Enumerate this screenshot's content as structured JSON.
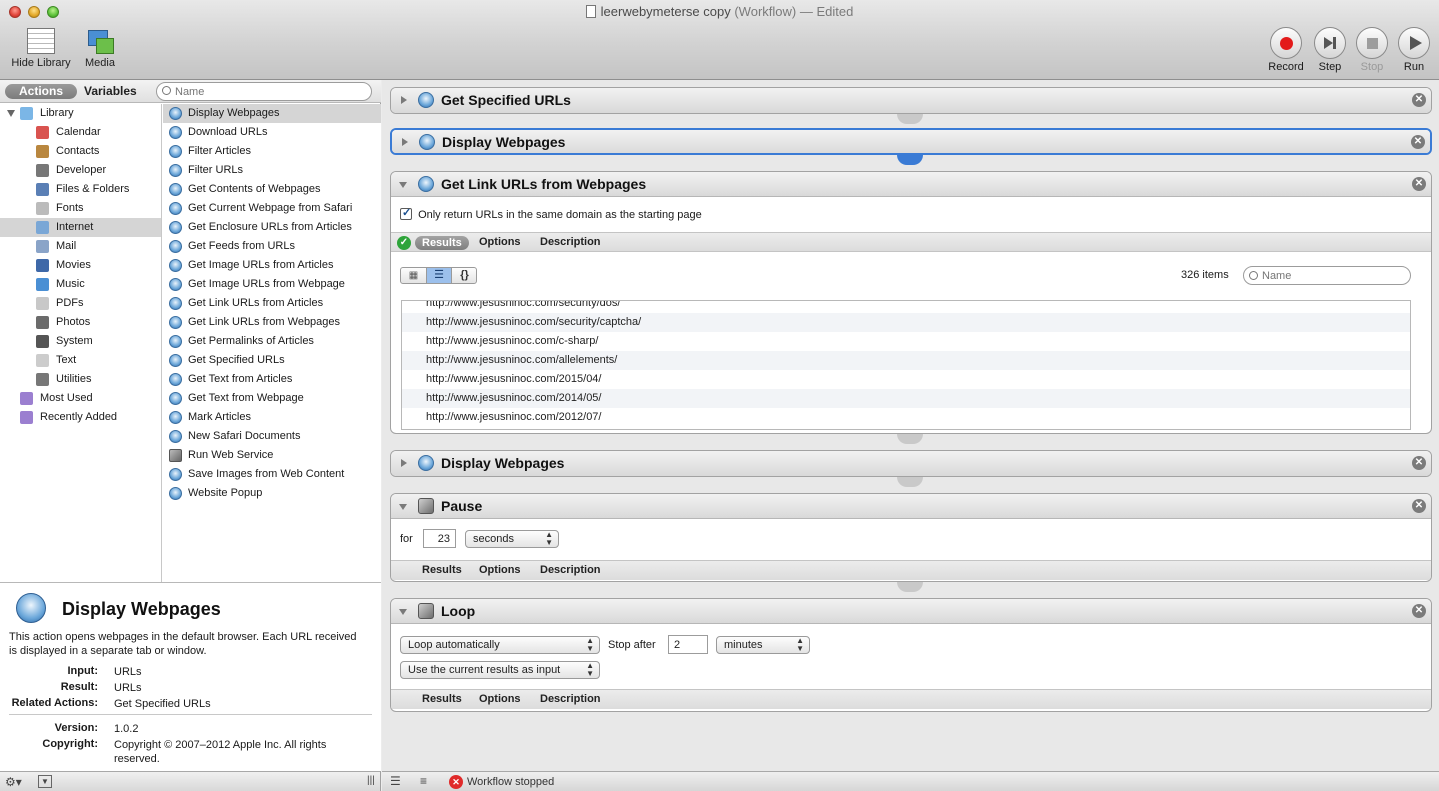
{
  "window": {
    "document_name": "leerwebymeterse copy",
    "document_kind": "(Workflow)",
    "document_state": "— Edited"
  },
  "toolbar": {
    "hide_library": "Hide Library",
    "media": "Media",
    "record": "Record",
    "step": "Step",
    "stop": "Stop",
    "run": "Run"
  },
  "library": {
    "tab_actions": "Actions",
    "tab_variables": "Variables",
    "search_placeholder": "Name",
    "categories": [
      {
        "label": "Library",
        "level": 0,
        "icon": "library-icon",
        "color": "#7bb6e6"
      },
      {
        "label": "Calendar",
        "level": 1,
        "icon": "calendar-icon",
        "color": "#d9534f"
      },
      {
        "label": "Contacts",
        "level": 1,
        "icon": "contacts-icon",
        "color": "#b9873f"
      },
      {
        "label": "Developer",
        "level": 1,
        "icon": "developer-icon",
        "color": "#777777"
      },
      {
        "label": "Files & Folders",
        "level": 1,
        "icon": "files-folders-icon",
        "color": "#5a7fb5"
      },
      {
        "label": "Fonts",
        "level": 1,
        "icon": "fonts-icon",
        "color": "#bbbbbb"
      },
      {
        "label": "Internet",
        "level": 1,
        "icon": "internet-icon",
        "color": "#7aa7d6",
        "selected": true
      },
      {
        "label": "Mail",
        "level": 1,
        "icon": "mail-icon",
        "color": "#8aa4c8"
      },
      {
        "label": "Movies",
        "level": 1,
        "icon": "movies-icon",
        "color": "#3e68a8"
      },
      {
        "label": "Music",
        "level": 1,
        "icon": "music-icon",
        "color": "#4a8fd4"
      },
      {
        "label": "PDFs",
        "level": 1,
        "icon": "pdfs-icon",
        "color": "#c8c8c8"
      },
      {
        "label": "Photos",
        "level": 1,
        "icon": "photos-icon",
        "color": "#6b6b6b"
      },
      {
        "label": "System",
        "level": 1,
        "icon": "system-icon",
        "color": "#555555"
      },
      {
        "label": "Text",
        "level": 1,
        "icon": "text-icon",
        "color": "#cccccc"
      },
      {
        "label": "Utilities",
        "level": 1,
        "icon": "utilities-icon",
        "color": "#777777"
      },
      {
        "label": "Most Used",
        "level": 0,
        "icon": "most-used-icon",
        "color": "#9b7fd0"
      },
      {
        "label": "Recently Added",
        "level": 0,
        "icon": "recently-added-icon",
        "color": "#9b7fd0"
      }
    ],
    "actions": [
      {
        "label": "Display Webpages",
        "selected": true
      },
      {
        "label": "Download URLs"
      },
      {
        "label": "Filter Articles"
      },
      {
        "label": "Filter URLs"
      },
      {
        "label": "Get Contents of Webpages"
      },
      {
        "label": "Get Current Webpage from Safari"
      },
      {
        "label": "Get Enclosure URLs from Articles"
      },
      {
        "label": "Get Feeds from URLs"
      },
      {
        "label": "Get Image URLs from Articles"
      },
      {
        "label": "Get Image URLs from Webpage"
      },
      {
        "label": "Get Link URLs from Articles"
      },
      {
        "label": "Get Link URLs from Webpages"
      },
      {
        "label": "Get Permalinks of Articles"
      },
      {
        "label": "Get Specified URLs"
      },
      {
        "label": "Get Text from Articles"
      },
      {
        "label": "Get Text from Webpage"
      },
      {
        "label": "Mark Articles"
      },
      {
        "label": "New Safari Documents"
      },
      {
        "label": "Run Web Service",
        "tool": true
      },
      {
        "label": "Save Images from Web Content"
      },
      {
        "label": "Website Popup"
      }
    ],
    "description": {
      "title": "Display Webpages",
      "text": "This action opens webpages in the default browser. Each URL received is displayed in a separate tab or window.",
      "input_label": "Input:",
      "input_value": "URLs",
      "result_label": "Result:",
      "result_value": "URLs",
      "related_label": "Related Actions:",
      "related_value": "Get Specified URLs",
      "version_label": "Version:",
      "version_value": "1.0.2",
      "copyright_label": "Copyright:",
      "copyright_value": "Copyright © 2007–2012 Apple Inc.  All rights reserved."
    }
  },
  "workflow": {
    "blocks": {
      "get_specified_urls": {
        "title": "Get Specified URLs"
      },
      "display_webpages_1": {
        "title": "Display Webpages"
      },
      "get_link_urls": {
        "title": "Get Link URLs from Webpages",
        "checkbox_label": "Only return URLs in the same domain as the starting page",
        "tab_results": "Results",
        "tab_options": "Options",
        "tab_description": "Description",
        "item_count": "326 items",
        "search_placeholder": "Name",
        "urls": [
          "http://www.jesusninoc.com/security/dos/",
          "http://www.jesusninoc.com/security/captcha/",
          "http://www.jesusninoc.com/c-sharp/",
          "http://www.jesusninoc.com/allelements/",
          "http://www.jesusninoc.com/2015/04/",
          "http://www.jesusninoc.com/2014/05/",
          "http://www.jesusninoc.com/2012/07/"
        ]
      },
      "display_webpages_2": {
        "title": "Display Webpages"
      },
      "pause": {
        "title": "Pause",
        "for_label": "for",
        "value": "23",
        "unit": "seconds",
        "tab_results": "Results",
        "tab_options": "Options",
        "tab_description": "Description"
      },
      "loop": {
        "title": "Loop",
        "mode": "Loop automatically",
        "stop_after_label": "Stop after",
        "stop_after_value": "2",
        "unit": "minutes",
        "input_mode": "Use the current results as input",
        "tab_results": "Results",
        "tab_options": "Options",
        "tab_description": "Description"
      }
    }
  },
  "status": {
    "text": "Workflow stopped"
  }
}
